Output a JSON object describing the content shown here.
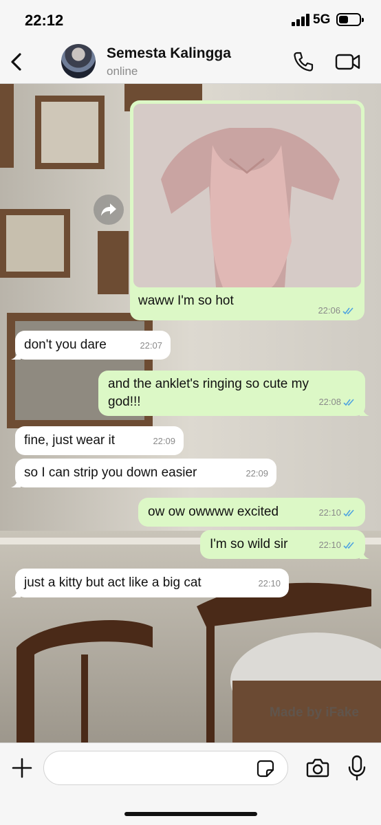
{
  "status_bar": {
    "time": "22:12",
    "network": "5G",
    "battery_level": 0.45,
    "icons": [
      "signal-bars-icon",
      "battery-icon"
    ]
  },
  "header": {
    "contact_name": "Semesta Kalingga",
    "contact_status": "online",
    "icons": [
      "back-chevron-icon",
      "phone-icon",
      "video-camera-icon"
    ]
  },
  "messages": [
    {
      "direction": "out",
      "type": "photo",
      "caption": "waww I'm so hot",
      "time": "22:06",
      "read": true
    },
    {
      "direction": "in",
      "text": "don't you dare",
      "time": "22:07"
    },
    {
      "direction": "out",
      "text_line1": "and the anklet's ringing so cute my",
      "text_line2": "god!!!",
      "time": "22:08",
      "read": true
    },
    {
      "direction": "in",
      "text": "fine, just wear it",
      "time": "22:09"
    },
    {
      "direction": "in",
      "text": "so I can strip you down easier",
      "time": "22:09"
    },
    {
      "direction": "out",
      "text": "ow ow owwww excited",
      "time": "22:10",
      "read": true
    },
    {
      "direction": "out",
      "text": "I'm so wild sir",
      "time": "22:10",
      "read": true
    },
    {
      "direction": "in",
      "text": "just a kitty but act like a big cat",
      "time": "22:10"
    }
  ],
  "watermark": "Made by iFake",
  "input_bar": {
    "placeholder": "",
    "icons": [
      "plus-icon",
      "sticker-icon",
      "camera-icon",
      "microphone-icon"
    ]
  },
  "colors": {
    "outgoing_bubble": "#dcf8c6",
    "incoming_bubble": "#ffffff",
    "read_ticks": "#4fa3e0",
    "bar_background": "#f6f6f6"
  }
}
